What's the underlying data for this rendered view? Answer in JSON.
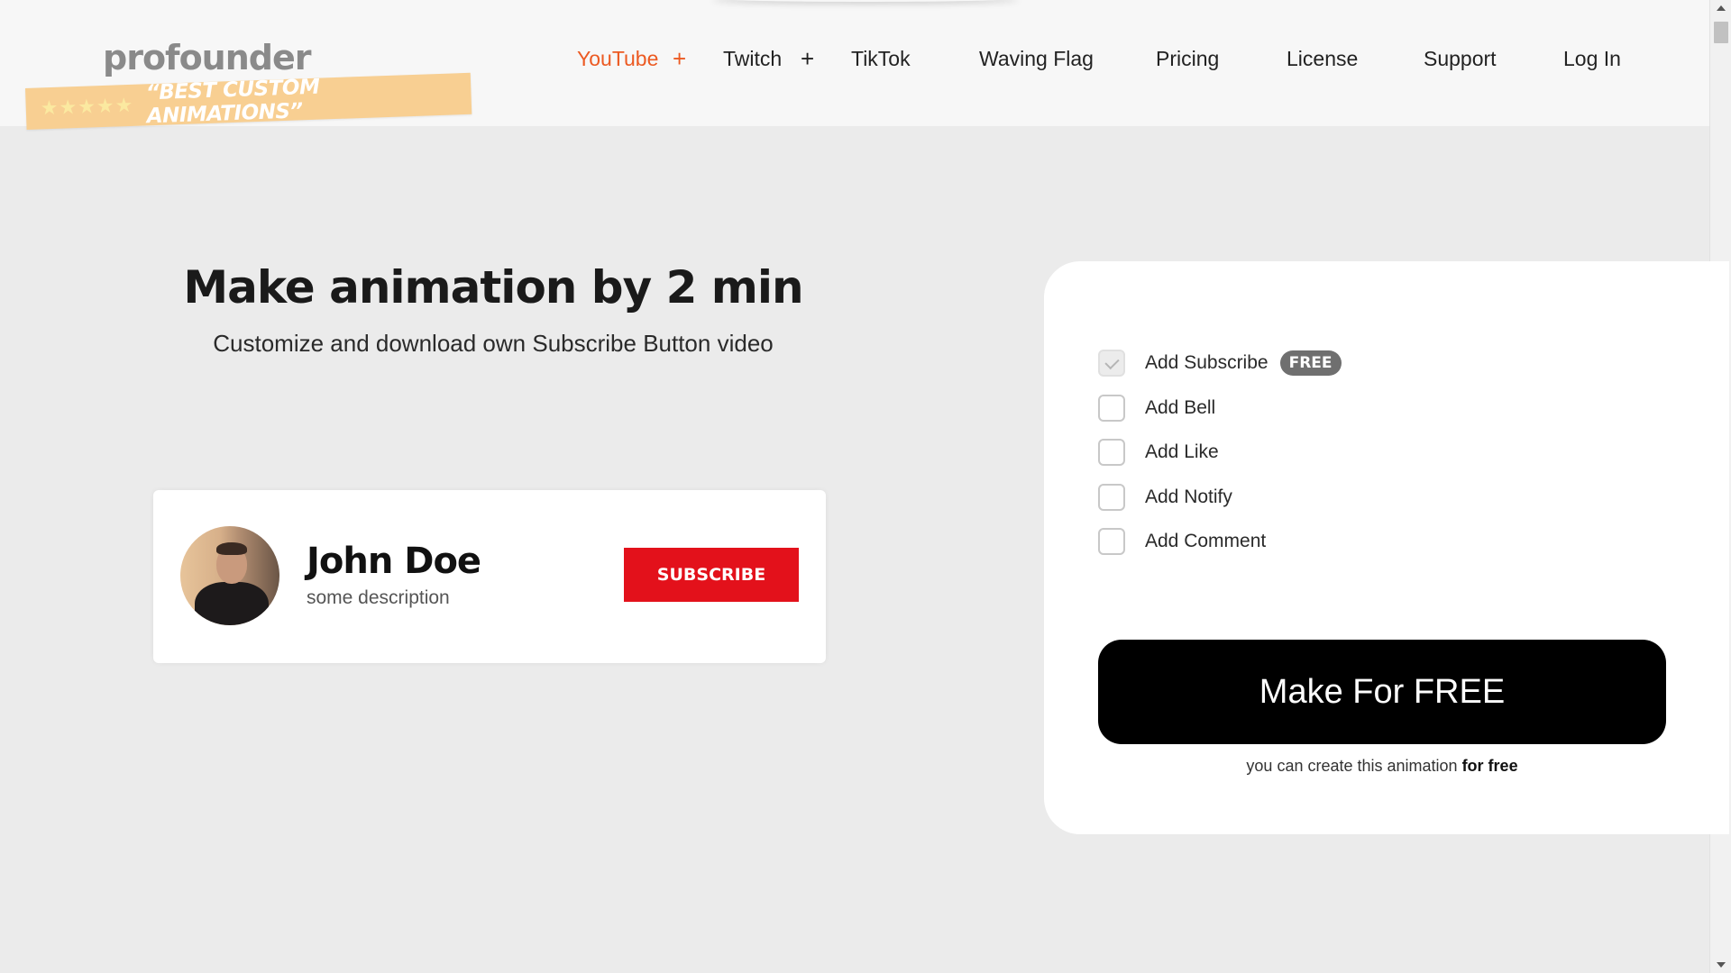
{
  "brand": {
    "logo_text": "profounder",
    "ribbon_stars": "★★★★★",
    "ribbon_text": "“BEST CUSTOM ANIMATIONS”"
  },
  "nav": {
    "items": [
      {
        "label": "YouTube",
        "has_plus": true,
        "active": true
      },
      {
        "label": "Twitch",
        "has_plus": true,
        "active": false
      },
      {
        "label": "TikTok",
        "has_plus": false,
        "active": false
      },
      {
        "label": "Waving Flag",
        "has_plus": false,
        "active": false
      },
      {
        "label": "Pricing",
        "has_plus": false,
        "active": false
      },
      {
        "label": "License",
        "has_plus": false,
        "active": false
      },
      {
        "label": "Support",
        "has_plus": false,
        "active": false
      },
      {
        "label": "Log In",
        "has_plus": false,
        "active": false
      }
    ],
    "plus_symbol": "+"
  },
  "hero": {
    "title": "Make animation by 2 min",
    "subtitle": "Customize and download own Subscribe Button video"
  },
  "preview": {
    "channel_name": "John Doe",
    "channel_description": "some description",
    "subscribe_label": "SUBSCRIBE",
    "subscribe_color": "#e3111b"
  },
  "options": {
    "items": [
      {
        "label": "Add Subscribe",
        "checked": true,
        "badge": "FREE"
      },
      {
        "label": "Add Bell",
        "checked": false
      },
      {
        "label": "Add Like",
        "checked": false
      },
      {
        "label": "Add Notify",
        "checked": false
      },
      {
        "label": "Add Comment",
        "checked": false
      }
    ],
    "make_button_label": "Make For FREE",
    "note_prefix": "you can create this animation ",
    "note_bold": "for free"
  },
  "colors": {
    "accent": "#ec5a22",
    "ribbon": "#f8cf92",
    "page_bg": "#ebebeb"
  }
}
